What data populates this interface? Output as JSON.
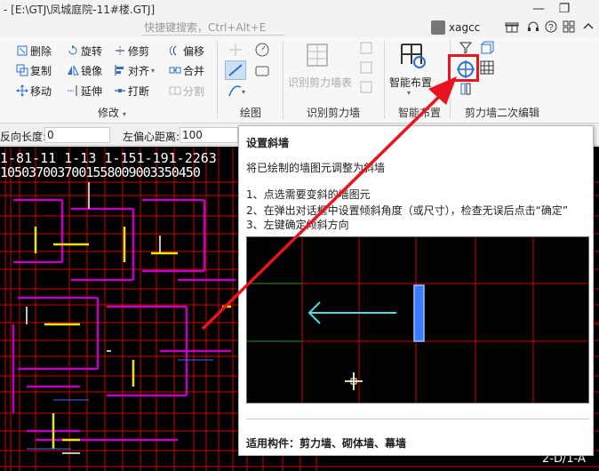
{
  "window": {
    "title": "- [E:\\GTJ\\凤城庭院-11#楼.GTJ]",
    "search_placeholder": "快捷键搜索，Ctrl+Alt+E",
    "username": "xagcc",
    "minimize": "—",
    "restore": "❐"
  },
  "ribbon": {
    "modify": {
      "label": "修改",
      "items": [
        "删除",
        "旋转",
        "修剪",
        "偏移",
        "复制",
        "镜像",
        "对齐",
        "合并",
        "移动",
        "延伸",
        "打断",
        "分割"
      ]
    },
    "draw": {
      "label": "绘图"
    },
    "recognize": {
      "label": "识别剪力墙",
      "button": "识别剪力墙表"
    },
    "smart": {
      "label": "智能布置",
      "button": "智能布置"
    },
    "secondary_edit": {
      "label": "剪力墙二次编辑"
    }
  },
  "statusbar": {
    "reverse_length_label": "反向长度:",
    "reverse_length_value": "0",
    "left_offset_label": "左偏心距离:",
    "left_offset_value": "100"
  },
  "canvas": {
    "axis_labels_top": "1-81-11  1-13  1-151-191-2263",
    "axis_dims_top": "1050370037001558009003350450",
    "corner_label": "2-D/1-A"
  },
  "tooltip": {
    "title": "设置斜墙",
    "description": "将已绘制的墙图元调整为斜墙",
    "steps": [
      "1、点选需要变斜的墙图元",
      "2、在弹出对话框中设置倾斜角度（或尺寸），检查无误后点击“确定”",
      "3、左键确定倾斜方向"
    ],
    "footer": "适用构件：剪力墙、砌体墙、幕墙"
  },
  "colors": {
    "highlight": "#e8141e",
    "canvas_bg": "#000000",
    "grid_red": "#d10000",
    "wall_magenta": "#c000c0",
    "wall_yellow": "#e8e800",
    "preview_cyan": "#4fdcdc",
    "preview_wall": "#3a7cff"
  }
}
